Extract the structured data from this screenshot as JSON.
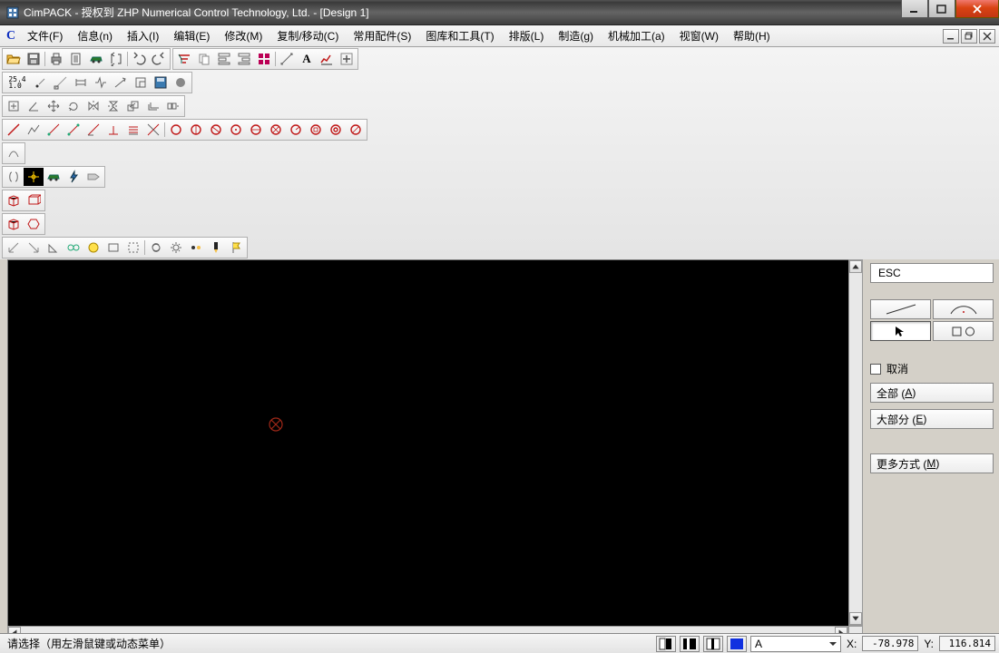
{
  "title": "CimPACK - 授权到 ZHP Numerical Control Technology, Ltd. - [Design 1]",
  "menu_logo": "C",
  "menu": [
    "文件(F)",
    "信息(n)",
    "插入(I)",
    "编辑(E)",
    "修改(M)",
    "复制/移动(C)",
    "常用配件(S)",
    "图库和工具(T)",
    "排版(L)",
    "制造(g)",
    "机械加工(a)",
    "视窗(W)",
    "帮助(H)"
  ],
  "rp": {
    "esc": "ESC",
    "cancel": "取消",
    "all_pre": "全部 ( ",
    "all_key": "A",
    "all_post": " )",
    "most_pre": "大部分 ( ",
    "most_key": "E",
    "most_post": " )",
    "more_pre": "更多方式 ( ",
    "more_key": "M",
    "more_post": " )"
  },
  "status": {
    "prompt": "请选择（用左滑鼠键或动态菜单）",
    "combo": "A",
    "xlabel": "X:",
    "ylabel": "Y:",
    "x": "-78.978",
    "y": "116.814"
  },
  "tb": {
    "dim": "25.4\n1.0"
  }
}
